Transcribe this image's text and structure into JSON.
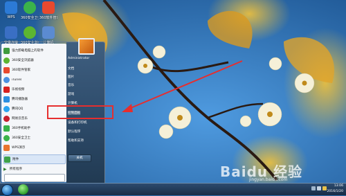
{
  "desktop": {
    "icons": [
      {
        "label": "WPS",
        "color": "#2c7ad6"
      },
      {
        "label": "360安全卫士",
        "color": "#3bb34a"
      },
      {
        "label": "360软件管家",
        "color": "#e8492e"
      },
      {
        "label": "宽带连接",
        "color": "#3a6fc4"
      },
      {
        "label": "360安全浏览器",
        "color": "#5cb531"
      },
      {
        "label": "计算机",
        "color": "#5b8bd1"
      }
    ]
  },
  "start_menu": {
    "programs": [
      {
        "label": "强力卸载电脑上的软件",
        "color": "#3e9b3e"
      },
      {
        "label": "360安全浏览器",
        "color": "#5cb531"
      },
      {
        "label": "360软件管家",
        "color": "#e8492e"
      },
      {
        "label": "iTunes",
        "color": "#4a90e2"
      },
      {
        "label": "乐视视频",
        "color": "#d7201f"
      },
      {
        "label": "腾讯播放器",
        "color": "#2b8ee0"
      },
      {
        "label": "腾讯QQ",
        "color": "#2aa4f1"
      },
      {
        "label": "网易云音乐",
        "color": "#c6202e"
      },
      {
        "label": "360手机助手",
        "color": "#37b24a"
      },
      {
        "label": "360安全卫士",
        "color": "#3bb34a"
      },
      {
        "label": "WPS演示",
        "color": "#e8742e"
      },
      {
        "label": "附件",
        "color": "#3fa34a"
      }
    ],
    "all_programs": "所有程序",
    "right_items": [
      {
        "label": "Administrator"
      },
      {
        "label": "文档"
      },
      {
        "label": "图片"
      },
      {
        "label": "音乐"
      },
      {
        "label": "游戏"
      },
      {
        "label": "计算机"
      },
      {
        "label": "控制面板"
      },
      {
        "label": "设备和打印机"
      },
      {
        "label": "默认程序"
      },
      {
        "label": "帮助和支持"
      }
    ],
    "shutdown": "关机"
  },
  "taskbar": {
    "time": "13:06",
    "date": "2016/1/20"
  },
  "watermark": {
    "brand": "Baidu 经验",
    "url": "jingyan.baidu.com"
  }
}
